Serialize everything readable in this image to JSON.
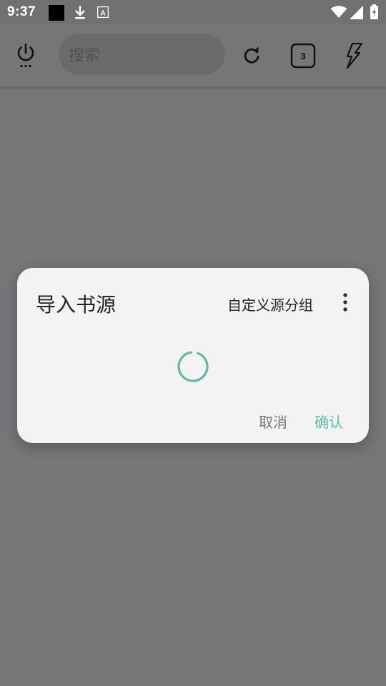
{
  "status_bar": {
    "time": "9:37",
    "icons": [
      "app-square-icon",
      "download-icon",
      "font-a-icon",
      "wifi-icon",
      "signal-icon",
      "battery-charging-icon"
    ],
    "font_icon_glyph": "A"
  },
  "toolbar": {
    "power_icon": "power-icon",
    "search_placeholder": "搜索",
    "refresh_icon": "refresh-icon",
    "tab_count": "3",
    "flash_icon": "lightning-icon"
  },
  "dialog": {
    "title": "导入书源",
    "group_label": "自定义源分组",
    "menu_icon": "more-vertical-icon",
    "cancel_label": "取消",
    "confirm_label": "确认",
    "accent_color": "#5fb7a8"
  },
  "colors": {
    "scrim": "#767679",
    "dialog_bg": "#f3f3f3"
  }
}
